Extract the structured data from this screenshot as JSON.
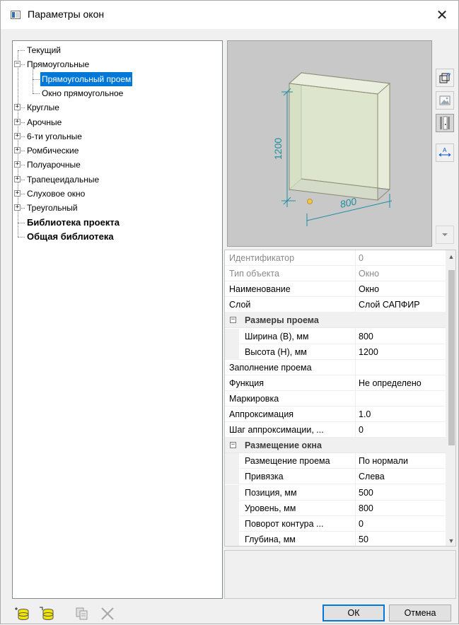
{
  "window": {
    "title": "Параметры окон",
    "close_glyph": "✕"
  },
  "tree": {
    "items": [
      {
        "label": "Текущий"
      },
      {
        "label": "Прямоугольные",
        "expander": "−"
      },
      {
        "label": "Прямоугольный проем",
        "selected": true
      },
      {
        "label": "Окно прямоугольное"
      },
      {
        "label": "Круглые",
        "expander": "+"
      },
      {
        "label": "Арочные",
        "expander": "+"
      },
      {
        "label": "6-ти угольные",
        "expander": "+"
      },
      {
        "label": "Ромбические",
        "expander": "+"
      },
      {
        "label": "Полуарочные",
        "expander": "+"
      },
      {
        "label": "Трапецеидальные",
        "expander": "+"
      },
      {
        "label": "Слуховое окно",
        "expander": "+"
      },
      {
        "label": "Треугольный",
        "expander": "+"
      },
      {
        "label": "Библиотека проекта",
        "bold": true
      },
      {
        "label": "Общая библиотека",
        "bold": true
      }
    ]
  },
  "preview": {
    "height_label": "1200",
    "width_label": "800",
    "box_fill": "#d9e2c8",
    "edge_color": "#8a8a70",
    "dim_color": "#1e8fa0"
  },
  "side_tools": {
    "icons": [
      "xy-view-icon",
      "image-icon",
      "wall-section-icon",
      "dimension-icon",
      "scroll-down-icon"
    ]
  },
  "props": {
    "rows": [
      {
        "name": "Идентификатор",
        "value": "0",
        "gray": true
      },
      {
        "name": "Тип объекта",
        "value": "Окно",
        "gray": true
      },
      {
        "name": "Наименование",
        "value": "Окно"
      },
      {
        "name": "Слой",
        "value": "Слой САПФИР"
      },
      {
        "name": "Размеры проема",
        "category": true,
        "toggle": "−"
      },
      {
        "name": "Ширина (B), мм",
        "value": "800",
        "indent": true
      },
      {
        "name": "Высота (H), мм",
        "value": "1200",
        "indent": true
      },
      {
        "name": "Заполнение проема",
        "value": ""
      },
      {
        "name": "Функция",
        "value": "Не определено"
      },
      {
        "name": "Маркировка",
        "value": ""
      },
      {
        "name": "Аппроксимация",
        "value": "1.0"
      },
      {
        "name": "Шаг аппроксимации, ...",
        "value": "0"
      },
      {
        "name": "Размещение окна",
        "category": true,
        "toggle": "−"
      },
      {
        "name": "Размещение проема",
        "value": "По нормали",
        "indent": true
      },
      {
        "name": "Привязка",
        "value": "Слева",
        "indent": true
      },
      {
        "name": "Позиция, мм",
        "value": "500",
        "indent": true
      },
      {
        "name": "Уровень, мм",
        "value": "800",
        "indent": true
      },
      {
        "name": "Поворот контура ...",
        "value": "0",
        "indent": true
      },
      {
        "name": "Глубина, мм",
        "value": "50",
        "indent": true
      }
    ],
    "scroll_up": "▲",
    "scroll_down": "▼"
  },
  "buttons": {
    "ok": "ОК",
    "cancel": "Отмена",
    "lib_icons": [
      "add-library-icon",
      "open-library-icon",
      "copy-library-icon",
      "delete-library-icon"
    ]
  },
  "colors": {
    "selection": "#0078d7",
    "library_yellow": "#f2e600"
  }
}
